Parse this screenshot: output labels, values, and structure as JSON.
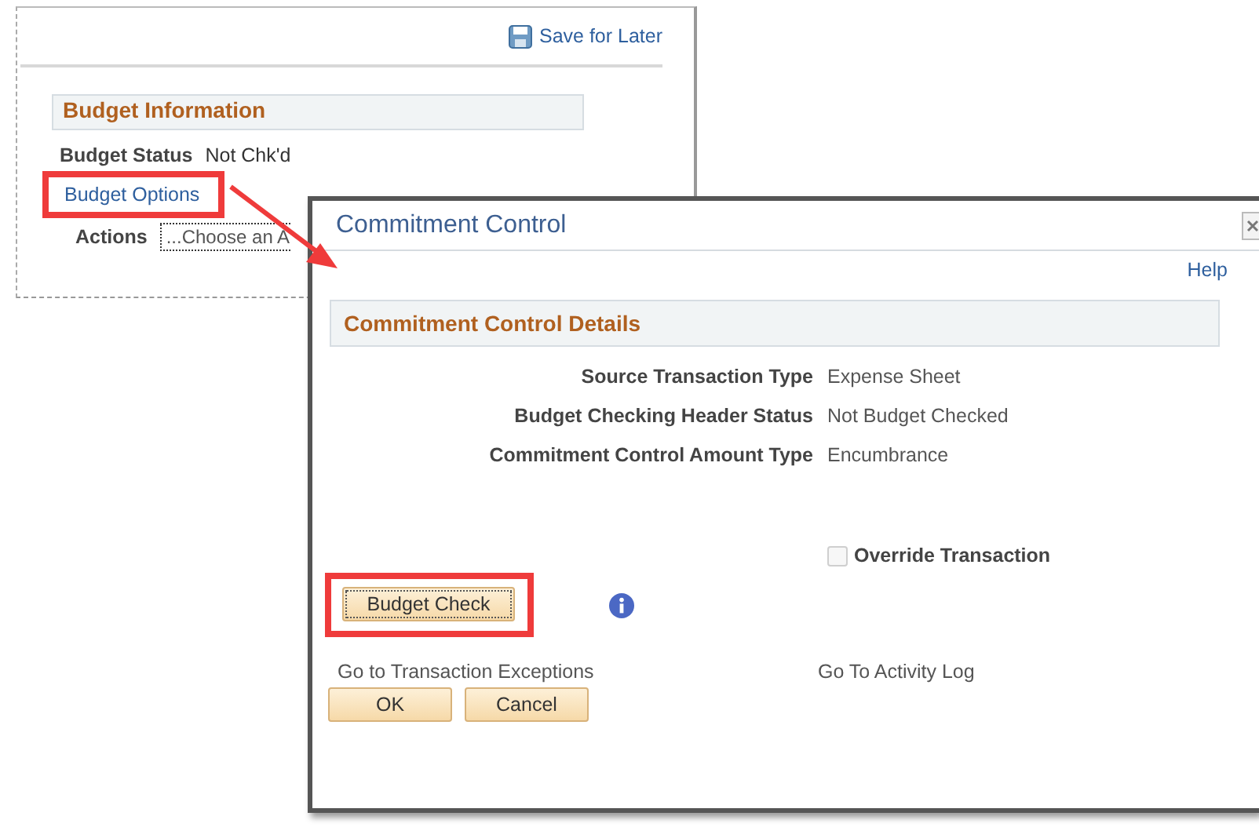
{
  "background_page": {
    "save_link": "Save for Later",
    "section_title": "Budget Information",
    "status": {
      "label": "Budget Status",
      "value": "Not Chk'd"
    },
    "options_link": {
      "label": "Budget Options",
      "highlighted": true
    },
    "actions": {
      "label": "Actions",
      "value": "...Choose an A"
    }
  },
  "dialog": {
    "title": "Commitment Control",
    "help_link": "Help",
    "section_title": "Commitment Control Details",
    "fields": [
      {
        "label": "Source Transaction Type",
        "value": "Expense Sheet"
      },
      {
        "label": "Budget Checking Header Status",
        "value": "Not Budget Checked"
      },
      {
        "label": "Commitment Control Amount Type",
        "value": "Encumbrance"
      }
    ],
    "override": {
      "label": "Override Transaction",
      "checked": false,
      "disabled": true
    },
    "budget_check": {
      "label": "Budget Check",
      "highlighted": true
    },
    "links": [
      "Go to Transaction Exceptions",
      "Go To Activity Log"
    ],
    "buttons": [
      "OK",
      "Cancel"
    ]
  }
}
